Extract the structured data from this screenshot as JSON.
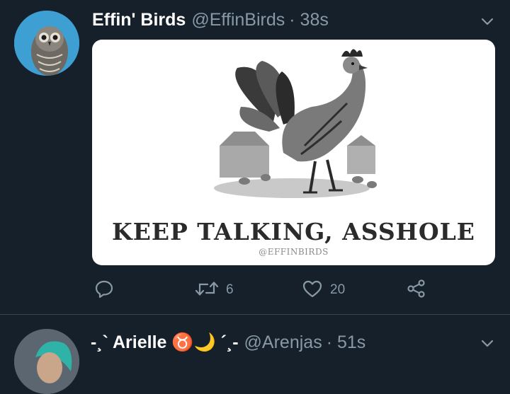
{
  "tweet1": {
    "display_name": "Effin' Birds",
    "handle": "@EffinBirds",
    "time": "· 38s",
    "image_caption": "KEEP TALKING, ASSHOLE",
    "image_watermark": "@EFFINBIRDS",
    "retweet_count": "6",
    "like_count": "20",
    "icons": {
      "avatar": "owl-avatar",
      "menu": "chevron-down-icon",
      "reply": "reply-icon",
      "retweet": "retweet-icon",
      "like": "heart-icon",
      "share": "share-icon"
    }
  },
  "tweet2": {
    "display_name": "-¸` Arielle ♉🌙 ´¸-",
    "handle": "@Arenjas",
    "time": "· 51s"
  },
  "colors": {
    "background": "#15202b",
    "secondary_text": "#8899a6",
    "divider": "#38444d"
  }
}
